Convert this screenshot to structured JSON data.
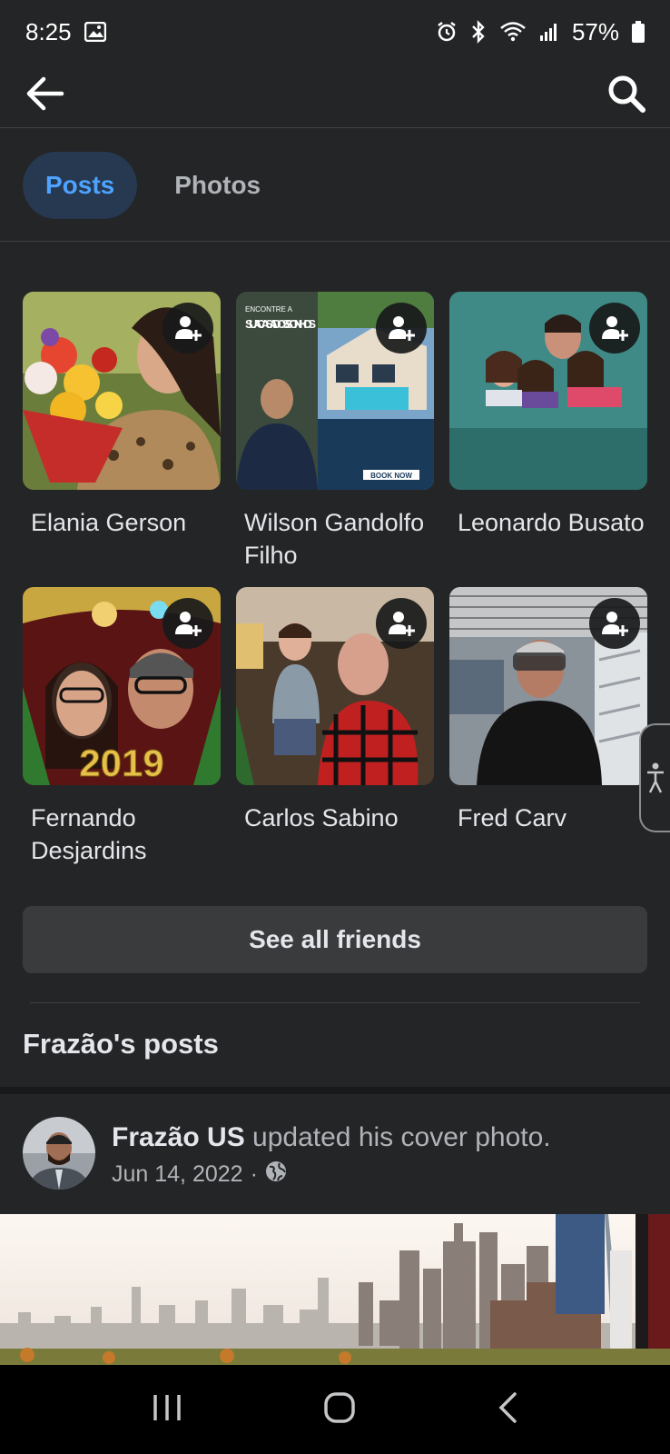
{
  "status_bar": {
    "time": "8:25",
    "battery": "57%",
    "icons": [
      "gallery-icon",
      "alarm-icon",
      "bluetooth-icon",
      "wifi-icon",
      "signal-icon",
      "battery-icon"
    ]
  },
  "app_bar": {
    "icons": [
      "back-arrow-icon",
      "search-icon"
    ]
  },
  "tabs": [
    {
      "label": "Posts",
      "active": true
    },
    {
      "label": "Photos",
      "active": false
    }
  ],
  "friends": [
    {
      "name": "Elania Gerson"
    },
    {
      "name": "Wilson Gandolfo Filho"
    },
    {
      "name": "Leonardo Busato"
    },
    {
      "name": "Fernando Desjardins"
    },
    {
      "name": "Carlos Sabino"
    },
    {
      "name": "Fred Carv"
    }
  ],
  "see_all_label": "See all friends",
  "posts_section_title": "Frazão's posts",
  "post": {
    "author": "Frazão US",
    "action": " updated his cover photo.",
    "date": "Jun 14, 2022",
    "separator": "·",
    "privacy_icon": "globe-icon"
  },
  "thumb_texts": {
    "ad_title": "SUA CASA DOS SONHOS",
    "ad_top": "ENCONTRE A",
    "ad_button": "BOOK NOW",
    "year_banner": "2019"
  },
  "colors": {
    "background": "#242526",
    "accent": "#4da3ff",
    "active_tab_bg": "#263951",
    "button_bg": "#3a3b3c"
  }
}
